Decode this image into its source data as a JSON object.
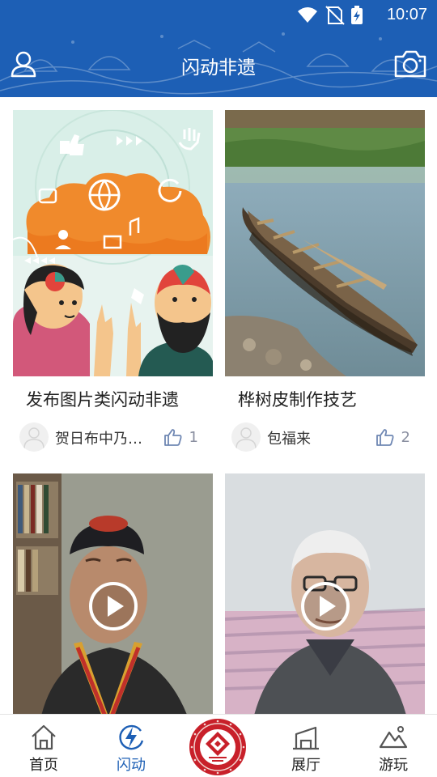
{
  "status_bar": {
    "time": "10:07",
    "icons": [
      "wifi-icon",
      "no-sim-icon",
      "battery-charging-icon"
    ]
  },
  "header": {
    "title": "闪动非遗",
    "left_icon": "user-icon",
    "right_icon": "camera-icon",
    "color": "#1d5fb5"
  },
  "feed": {
    "items": [
      {
        "title": "发布图片类闪动非遗",
        "author": "贺日布中乃…",
        "likes": "1",
        "media": "image"
      },
      {
        "title": "桦树皮制作技艺",
        "author": "包福来",
        "likes": "2",
        "media": "image"
      },
      {
        "title": "",
        "author": "",
        "likes": "",
        "media": "video"
      },
      {
        "title": "",
        "author": "",
        "likes": "",
        "media": "video"
      }
    ]
  },
  "tabbar": {
    "active": "闪动",
    "active_color": "#1d5fb5",
    "tabs": [
      {
        "label": "首页",
        "icon": "home-icon"
      },
      {
        "label": "闪动",
        "icon": "lightning-icon"
      },
      {
        "label": "",
        "icon": "museum-logo-icon"
      },
      {
        "label": "展厅",
        "icon": "exhibition-hall-icon"
      },
      {
        "label": "游玩",
        "icon": "mountain-icon"
      }
    ]
  }
}
